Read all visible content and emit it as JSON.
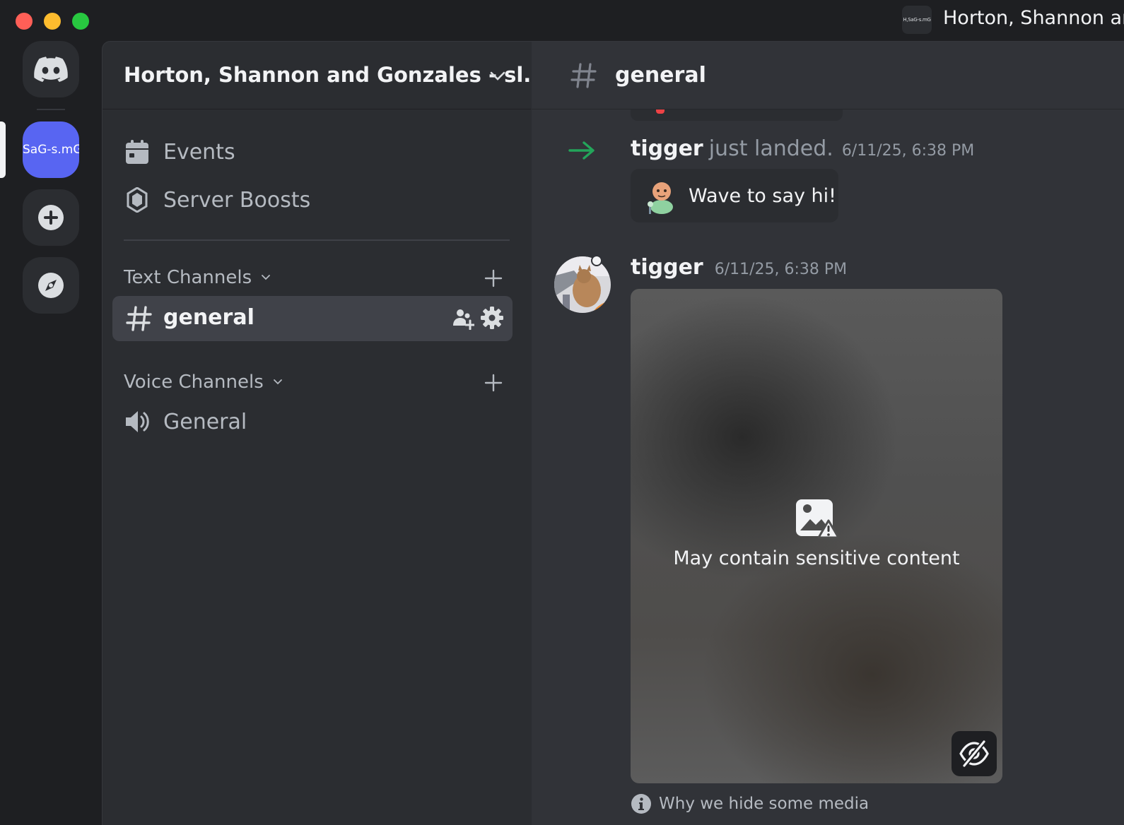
{
  "window": {
    "title": "Horton, Shannon and Gonzales - slack",
    "title_visible": "Horton, Shannon and",
    "icon_text": "H,SaG-s.mG"
  },
  "rail": {
    "server_label": "SaG-s.mG",
    "accent": "#5865f2"
  },
  "sidebar": {
    "server_name": "Horton, Shannon and Gonzales - sl...",
    "items": [
      {
        "label": "Events",
        "icon": "calendar-icon"
      },
      {
        "label": "Server Boosts",
        "icon": "boost-icon"
      }
    ],
    "text_category": "Text Channels",
    "voice_category": "Voice Channels",
    "text_channels": [
      {
        "label": "general",
        "active": true
      }
    ],
    "voice_channels": [
      {
        "label": "General"
      }
    ]
  },
  "chat": {
    "channel": "general",
    "join": {
      "user": "tigger",
      "text": "just landed.",
      "timestamp": "6/11/25, 6:38 PM",
      "wave_label": "Wave to say hi!"
    },
    "message": {
      "user": "tigger",
      "timestamp": "6/11/25, 6:38 PM",
      "media_warning": "May contain sensitive content",
      "why_label": "Why we hide some media"
    }
  }
}
